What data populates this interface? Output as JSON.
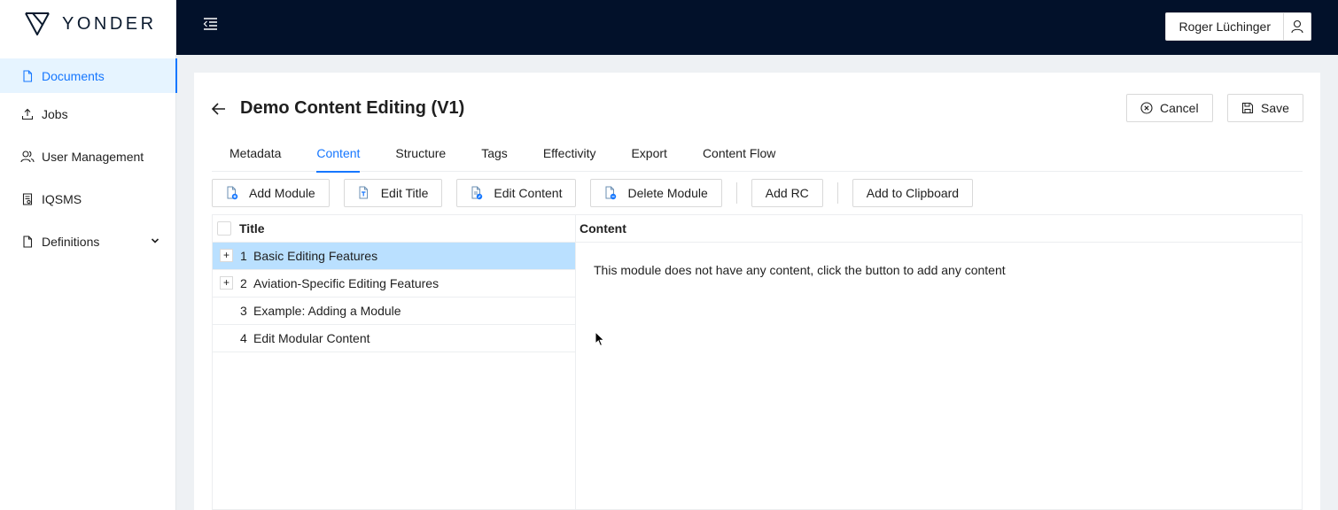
{
  "brand": {
    "name": "YONDER"
  },
  "sidebar": {
    "items": [
      {
        "label": "Documents",
        "icon": "file-icon",
        "active": true
      },
      {
        "label": "Jobs",
        "icon": "upload-icon"
      },
      {
        "label": "User Management",
        "icon": "users-icon"
      },
      {
        "label": "IQSMS",
        "icon": "report-icon"
      },
      {
        "label": "Definitions",
        "icon": "file-icon",
        "has_children": true
      }
    ]
  },
  "header": {
    "user_name": "Roger Lüchinger"
  },
  "page": {
    "title": "Demo Content Editing (V1)",
    "cancel_label": "Cancel",
    "save_label": "Save"
  },
  "tabs": [
    {
      "label": "Metadata"
    },
    {
      "label": "Content",
      "active": true
    },
    {
      "label": "Structure"
    },
    {
      "label": "Tags"
    },
    {
      "label": "Effectivity"
    },
    {
      "label": "Export"
    },
    {
      "label": "Content Flow"
    }
  ],
  "toolbar": {
    "add_module": "Add Module",
    "edit_title": "Edit Title",
    "edit_content": "Edit Content",
    "delete_module": "Delete Module",
    "add_rc": "Add RC",
    "add_to_clipboard": "Add to Clipboard"
  },
  "tree": {
    "header": "Title",
    "rows": [
      {
        "num": "1",
        "title": "Basic Editing Features",
        "expandable": true,
        "selected": true
      },
      {
        "num": "2",
        "title": "Aviation-Specific Editing Features",
        "expandable": true
      },
      {
        "num": "3",
        "title": "Example: Adding a Module"
      },
      {
        "num": "4",
        "title": "Edit Modular Content"
      }
    ]
  },
  "content": {
    "header": "Content",
    "empty_message": "This module does not have any content, click the button to add any content"
  },
  "colors": {
    "accent": "#1677ff",
    "topbar": "#02112a",
    "selected_row": "#bae0ff"
  }
}
